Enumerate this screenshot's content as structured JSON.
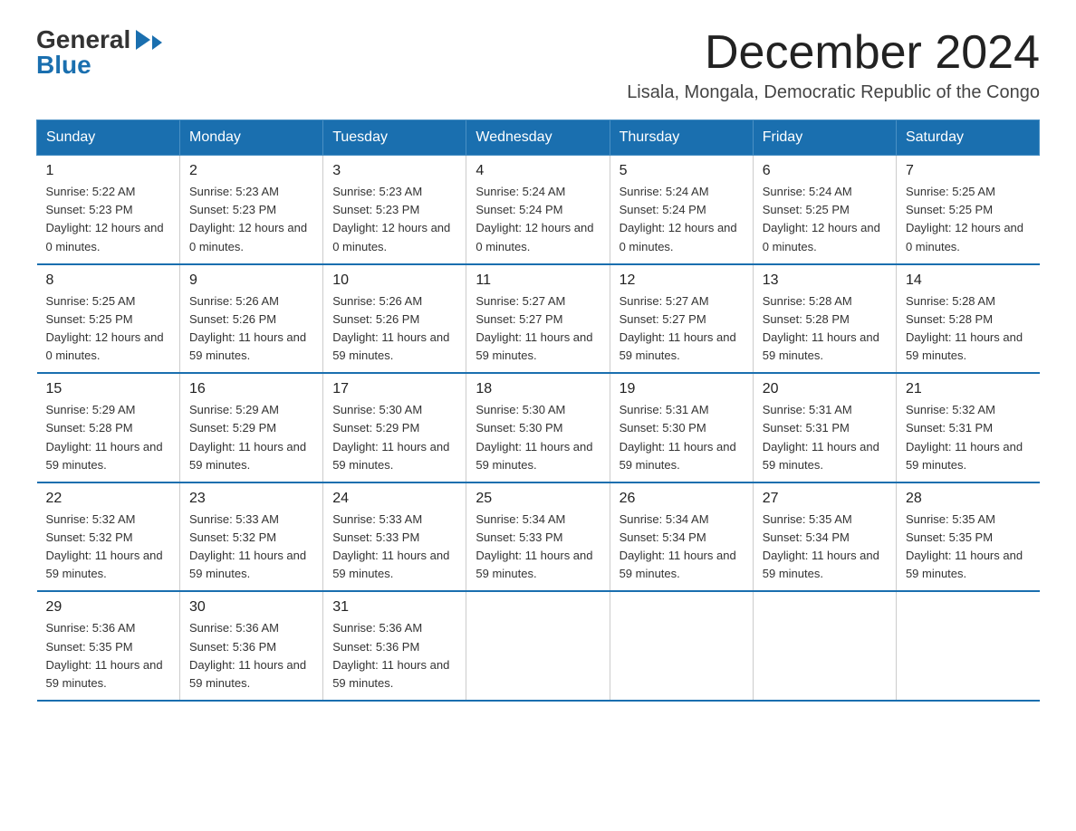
{
  "logo": {
    "general": "General",
    "blue": "Blue"
  },
  "title": "December 2024",
  "location": "Lisala, Mongala, Democratic Republic of the Congo",
  "headers": [
    "Sunday",
    "Monday",
    "Tuesday",
    "Wednesday",
    "Thursday",
    "Friday",
    "Saturday"
  ],
  "weeks": [
    [
      {
        "day": "1",
        "sunrise": "5:22 AM",
        "sunset": "5:23 PM",
        "daylight": "12 hours and 0 minutes."
      },
      {
        "day": "2",
        "sunrise": "5:23 AM",
        "sunset": "5:23 PM",
        "daylight": "12 hours and 0 minutes."
      },
      {
        "day": "3",
        "sunrise": "5:23 AM",
        "sunset": "5:23 PM",
        "daylight": "12 hours and 0 minutes."
      },
      {
        "day": "4",
        "sunrise": "5:24 AM",
        "sunset": "5:24 PM",
        "daylight": "12 hours and 0 minutes."
      },
      {
        "day": "5",
        "sunrise": "5:24 AM",
        "sunset": "5:24 PM",
        "daylight": "12 hours and 0 minutes."
      },
      {
        "day": "6",
        "sunrise": "5:24 AM",
        "sunset": "5:25 PM",
        "daylight": "12 hours and 0 minutes."
      },
      {
        "day": "7",
        "sunrise": "5:25 AM",
        "sunset": "5:25 PM",
        "daylight": "12 hours and 0 minutes."
      }
    ],
    [
      {
        "day": "8",
        "sunrise": "5:25 AM",
        "sunset": "5:25 PM",
        "daylight": "12 hours and 0 minutes."
      },
      {
        "day": "9",
        "sunrise": "5:26 AM",
        "sunset": "5:26 PM",
        "daylight": "11 hours and 59 minutes."
      },
      {
        "day": "10",
        "sunrise": "5:26 AM",
        "sunset": "5:26 PM",
        "daylight": "11 hours and 59 minutes."
      },
      {
        "day": "11",
        "sunrise": "5:27 AM",
        "sunset": "5:27 PM",
        "daylight": "11 hours and 59 minutes."
      },
      {
        "day": "12",
        "sunrise": "5:27 AM",
        "sunset": "5:27 PM",
        "daylight": "11 hours and 59 minutes."
      },
      {
        "day": "13",
        "sunrise": "5:28 AM",
        "sunset": "5:28 PM",
        "daylight": "11 hours and 59 minutes."
      },
      {
        "day": "14",
        "sunrise": "5:28 AM",
        "sunset": "5:28 PM",
        "daylight": "11 hours and 59 minutes."
      }
    ],
    [
      {
        "day": "15",
        "sunrise": "5:29 AM",
        "sunset": "5:28 PM",
        "daylight": "11 hours and 59 minutes."
      },
      {
        "day": "16",
        "sunrise": "5:29 AM",
        "sunset": "5:29 PM",
        "daylight": "11 hours and 59 minutes."
      },
      {
        "day": "17",
        "sunrise": "5:30 AM",
        "sunset": "5:29 PM",
        "daylight": "11 hours and 59 minutes."
      },
      {
        "day": "18",
        "sunrise": "5:30 AM",
        "sunset": "5:30 PM",
        "daylight": "11 hours and 59 minutes."
      },
      {
        "day": "19",
        "sunrise": "5:31 AM",
        "sunset": "5:30 PM",
        "daylight": "11 hours and 59 minutes."
      },
      {
        "day": "20",
        "sunrise": "5:31 AM",
        "sunset": "5:31 PM",
        "daylight": "11 hours and 59 minutes."
      },
      {
        "day": "21",
        "sunrise": "5:32 AM",
        "sunset": "5:31 PM",
        "daylight": "11 hours and 59 minutes."
      }
    ],
    [
      {
        "day": "22",
        "sunrise": "5:32 AM",
        "sunset": "5:32 PM",
        "daylight": "11 hours and 59 minutes."
      },
      {
        "day": "23",
        "sunrise": "5:33 AM",
        "sunset": "5:32 PM",
        "daylight": "11 hours and 59 minutes."
      },
      {
        "day": "24",
        "sunrise": "5:33 AM",
        "sunset": "5:33 PM",
        "daylight": "11 hours and 59 minutes."
      },
      {
        "day": "25",
        "sunrise": "5:34 AM",
        "sunset": "5:33 PM",
        "daylight": "11 hours and 59 minutes."
      },
      {
        "day": "26",
        "sunrise": "5:34 AM",
        "sunset": "5:34 PM",
        "daylight": "11 hours and 59 minutes."
      },
      {
        "day": "27",
        "sunrise": "5:35 AM",
        "sunset": "5:34 PM",
        "daylight": "11 hours and 59 minutes."
      },
      {
        "day": "28",
        "sunrise": "5:35 AM",
        "sunset": "5:35 PM",
        "daylight": "11 hours and 59 minutes."
      }
    ],
    [
      {
        "day": "29",
        "sunrise": "5:36 AM",
        "sunset": "5:35 PM",
        "daylight": "11 hours and 59 minutes."
      },
      {
        "day": "30",
        "sunrise": "5:36 AM",
        "sunset": "5:36 PM",
        "daylight": "11 hours and 59 minutes."
      },
      {
        "day": "31",
        "sunrise": "5:36 AM",
        "sunset": "5:36 PM",
        "daylight": "11 hours and 59 minutes."
      },
      null,
      null,
      null,
      null
    ]
  ]
}
